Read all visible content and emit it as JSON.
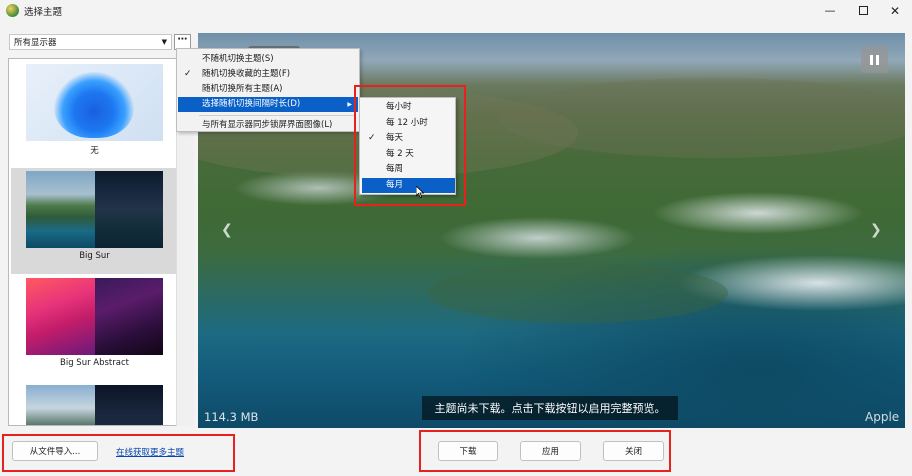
{
  "window": {
    "title": "选择主题"
  },
  "monitor_select": {
    "value": "所有显示器"
  },
  "more_button": {
    "label": "⋯"
  },
  "themes": [
    {
      "label": "无"
    },
    {
      "label": "Big Sur"
    },
    {
      "label": "Big Sur Abstract"
    },
    {
      "label": ""
    }
  ],
  "context_menu": {
    "items": [
      {
        "label": "不随机切换主题(S)",
        "checked": false
      },
      {
        "label": "随机切换收藏的主题(F)",
        "checked": true
      },
      {
        "label": "随机切换所有主题(A)",
        "checked": false
      },
      {
        "label": "选择随机切换间隔时长(D)",
        "checked": false,
        "highlighted": true,
        "submenu": true
      },
      {
        "label": "与所有显示器同步锁屏界面图像(L)",
        "checked": false
      }
    ]
  },
  "interval_submenu": {
    "items": [
      {
        "label": "每小时",
        "checked": false
      },
      {
        "label": "每 12 小时",
        "checked": false
      },
      {
        "label": "每天",
        "checked": true
      },
      {
        "label": "每 2 天",
        "checked": false
      },
      {
        "label": "每周",
        "checked": false
      },
      {
        "label": "每月",
        "checked": false,
        "highlighted": true
      }
    ]
  },
  "preview": {
    "size": "114.3 MB",
    "author": "Apple",
    "status": "主题尚未下载。点击下载按钮以启用完整预览。"
  },
  "footer": {
    "import_label": "从文件导入...",
    "online_link": "在线获取更多主题",
    "download_label": "下载",
    "apply_label": "应用",
    "close_label": "关闭"
  },
  "colors": {
    "accent": "#0a60c6",
    "highlight_box": "#e8211f",
    "link": "#0645ad"
  },
  "icons": [
    "app-icon",
    "minimize-icon",
    "maximize-icon",
    "close-icon",
    "chevron-down-icon",
    "pause-icon",
    "chevron-left-icon",
    "chevron-right-icon",
    "checkmark-icon",
    "submenu-arrow-icon",
    "cursor-icon"
  ]
}
